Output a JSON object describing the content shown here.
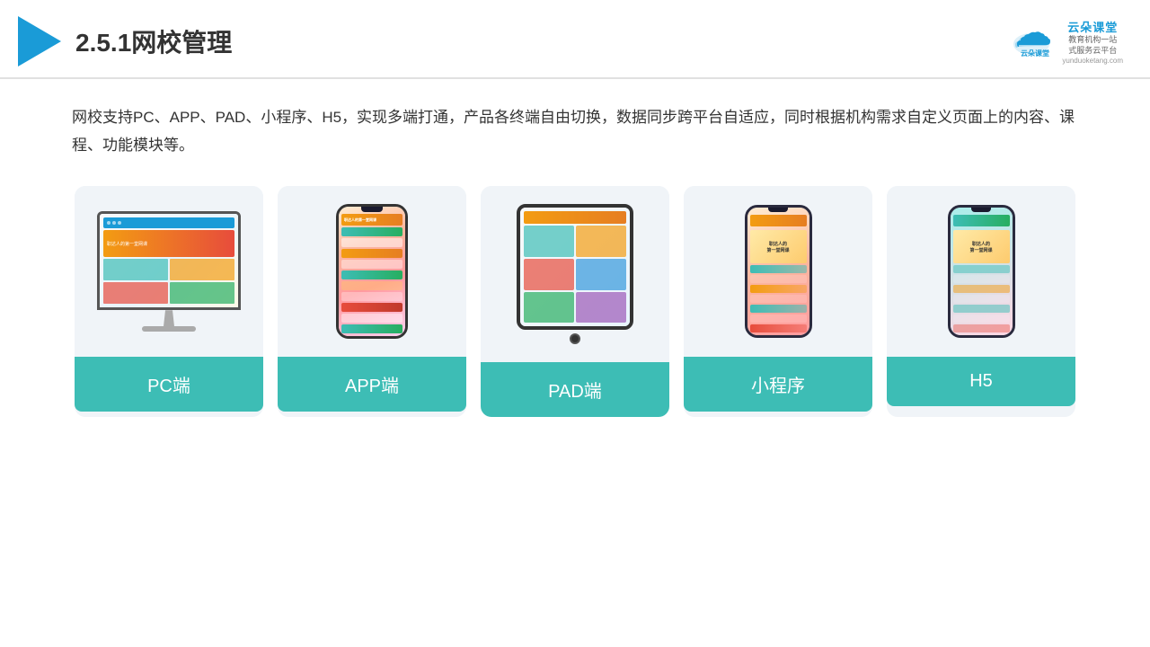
{
  "header": {
    "title": "2.5.1网校管理",
    "brand_name": "云朵课堂",
    "brand_url": "yunduoketang.com",
    "brand_tagline_line1": "教育机构一站",
    "brand_tagline_line2": "式服务云平台"
  },
  "description": {
    "text": "网校支持PC、APP、PAD、小程序、H5，实现多端打通，产品各终端自由切换，数据同步跨平台自适应，同时根据机构需求自定义页面上的内容、课程、功能模块等。"
  },
  "cards": [
    {
      "id": "pc",
      "label": "PC端"
    },
    {
      "id": "app",
      "label": "APP端"
    },
    {
      "id": "pad",
      "label": "PAD端"
    },
    {
      "id": "miniprogram",
      "label": "小程序"
    },
    {
      "id": "h5",
      "label": "H5"
    }
  ]
}
